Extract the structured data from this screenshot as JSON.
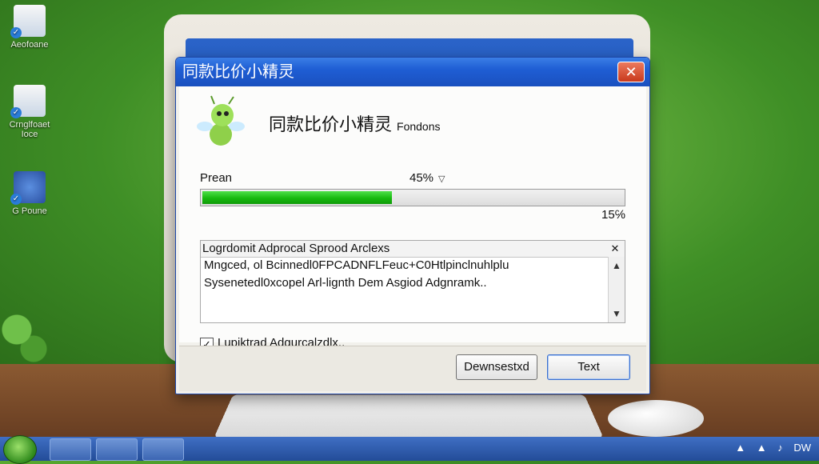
{
  "desktop": {
    "icons": [
      {
        "label": "Aeofoane",
        "icon": "folder-icon"
      },
      {
        "label": "Crnglfoaet\nIoce",
        "icon": "document-icon"
      },
      {
        "label": "G Poune",
        "icon": "mascot-icon"
      }
    ]
  },
  "dialog": {
    "title": "同款比价小精灵",
    "heading": "同款比价小精灵",
    "heading_sub": "Fondons",
    "progress_label": "Prean",
    "progress_percent_text": "45%",
    "progress_value": 0.45,
    "speed_text": "15℅",
    "log": {
      "header": "Logrdomit Adprocal Sprood Arclexs",
      "lines": [
        "Mngced, ol Bcinnedl0FPCADNFLFeuc+C0Htlpinclnuhlplu",
        "Sysenetedl0xcopel Arl-lignth Dem Asgiod Adgnramk.."
      ]
    },
    "checkbox": {
      "label": "Lupiktrad Adgurcalzdlx..",
      "checked": true
    },
    "buttons": {
      "secondary": "Dewnsestxd",
      "primary": "Text"
    }
  },
  "taskbar": {
    "tray_text": "DW"
  },
  "colors": {
    "title_bar": "#1f5ed4",
    "progress_fill": "#17b90f",
    "close_button": "#c8391c"
  }
}
